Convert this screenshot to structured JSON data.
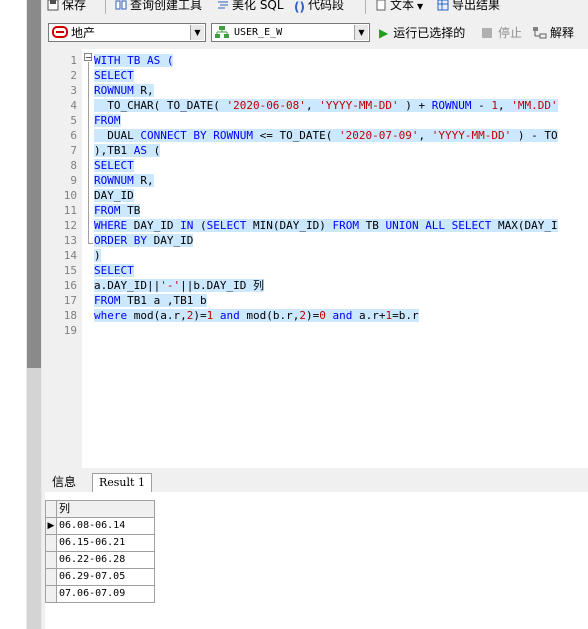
{
  "toolbar": {
    "save": "保存",
    "query_builder": "查询创建工具",
    "beautify_sql": "美化 SQL",
    "code_snippet": "代码段",
    "text": "文本",
    "export": "导出结果"
  },
  "bar2": {
    "connection": "地产",
    "schema": "USER_E_W",
    "run_selected": "运行已选择的",
    "stop": "停止",
    "explain": "解释"
  },
  "editor": {
    "line_numbers": [
      "1",
      "2",
      "3",
      "4",
      "5",
      "6",
      "7",
      "8",
      "9",
      "10",
      "11",
      "12",
      "13",
      "14",
      "15",
      "16",
      "17",
      "18",
      "19"
    ],
    "lines": [
      [
        {
          "t": "WITH TB AS (",
          "c": "kw"
        }
      ],
      [
        {
          "t": "SELECT",
          "c": "kw"
        }
      ],
      [
        {
          "t": "ROWNUM",
          "c": "kw"
        },
        {
          "t": " R,",
          "c": "id"
        }
      ],
      [
        {
          "t": "  TO_CHAR( TO_DATE( ",
          "c": "id"
        },
        {
          "t": "'2020-06-08'",
          "c": "str"
        },
        {
          "t": ", ",
          "c": "id"
        },
        {
          "t": "'YYYY-MM-DD'",
          "c": "str"
        },
        {
          "t": " ) + ",
          "c": "id"
        },
        {
          "t": "ROWNUM",
          "c": "kw"
        },
        {
          "t": " - ",
          "c": "id"
        },
        {
          "t": "1",
          "c": "num"
        },
        {
          "t": ", ",
          "c": "id"
        },
        {
          "t": "'MM.DD'",
          "c": "str"
        }
      ],
      [
        {
          "t": "FROM",
          "c": "kw"
        }
      ],
      [
        {
          "t": "  DUAL ",
          "c": "id"
        },
        {
          "t": "CONNECT BY ROWNUM",
          "c": "kw"
        },
        {
          "t": " <= TO_DATE( ",
          "c": "id"
        },
        {
          "t": "'2020-07-09'",
          "c": "str"
        },
        {
          "t": ", ",
          "c": "id"
        },
        {
          "t": "'YYYY-MM-DD'",
          "c": "str"
        },
        {
          "t": " ) - TO",
          "c": "id"
        }
      ],
      [
        {
          "t": "),TB1 ",
          "c": "id"
        },
        {
          "t": "AS",
          "c": "kw"
        },
        {
          "t": " (",
          "c": "id"
        }
      ],
      [
        {
          "t": "SELECT",
          "c": "kw"
        }
      ],
      [
        {
          "t": "ROWNUM",
          "c": "kw"
        },
        {
          "t": " R,",
          "c": "id"
        }
      ],
      [
        {
          "t": "DAY_ID",
          "c": "id"
        }
      ],
      [
        {
          "t": "FROM",
          "c": "kw"
        },
        {
          "t": " TB",
          "c": "id"
        }
      ],
      [
        {
          "t": "WHERE",
          "c": "kw"
        },
        {
          "t": " DAY_ID ",
          "c": "id"
        },
        {
          "t": "IN",
          "c": "kw"
        },
        {
          "t": " (",
          "c": "id"
        },
        {
          "t": "SELECT",
          "c": "kw"
        },
        {
          "t": " MIN(DAY_ID) ",
          "c": "id"
        },
        {
          "t": "FROM",
          "c": "kw"
        },
        {
          "t": " TB ",
          "c": "id"
        },
        {
          "t": "UNION ALL SELECT",
          "c": "kw"
        },
        {
          "t": " MAX(DAY_I",
          "c": "id"
        }
      ],
      [
        {
          "t": "ORDER BY",
          "c": "kw"
        },
        {
          "t": " DAY_ID",
          "c": "id"
        }
      ],
      [
        {
          "t": ")",
          "c": "id"
        }
      ],
      [
        {
          "t": "SELECT",
          "c": "kw"
        }
      ],
      [
        {
          "t": "a.DAY_ID||",
          "c": "id"
        },
        {
          "t": "'-'",
          "c": "str"
        },
        {
          "t": "||b.DAY_ID 列",
          "c": "id"
        }
      ],
      [
        {
          "t": "FROM",
          "c": "kw"
        },
        {
          "t": " TB1 a ,TB1 b",
          "c": "id"
        }
      ],
      [
        {
          "t": "where",
          "c": "kw"
        },
        {
          "t": " mod(a.r,",
          "c": "id"
        },
        {
          "t": "2",
          "c": "num"
        },
        {
          "t": ")=",
          "c": "id"
        },
        {
          "t": "1",
          "c": "num"
        },
        {
          "t": " ",
          "c": "id"
        },
        {
          "t": "and",
          "c": "kw"
        },
        {
          "t": " mod(b.r,",
          "c": "id"
        },
        {
          "t": "2",
          "c": "num"
        },
        {
          "t": ")=",
          "c": "id"
        },
        {
          "t": "0",
          "c": "num"
        },
        {
          "t": " ",
          "c": "id"
        },
        {
          "t": "and",
          "c": "kw"
        },
        {
          "t": " a.r+",
          "c": "id"
        },
        {
          "t": "1",
          "c": "num"
        },
        {
          "t": "=b.r",
          "c": "id"
        }
      ],
      []
    ]
  },
  "results": {
    "tab_info": "信息",
    "tab_result": "Result 1",
    "column_header": "列",
    "rows": [
      "06.08-06.14",
      "06.15-06.21",
      "06.22-06.28",
      "06.29-07.05",
      "07.06-07.09"
    ]
  }
}
